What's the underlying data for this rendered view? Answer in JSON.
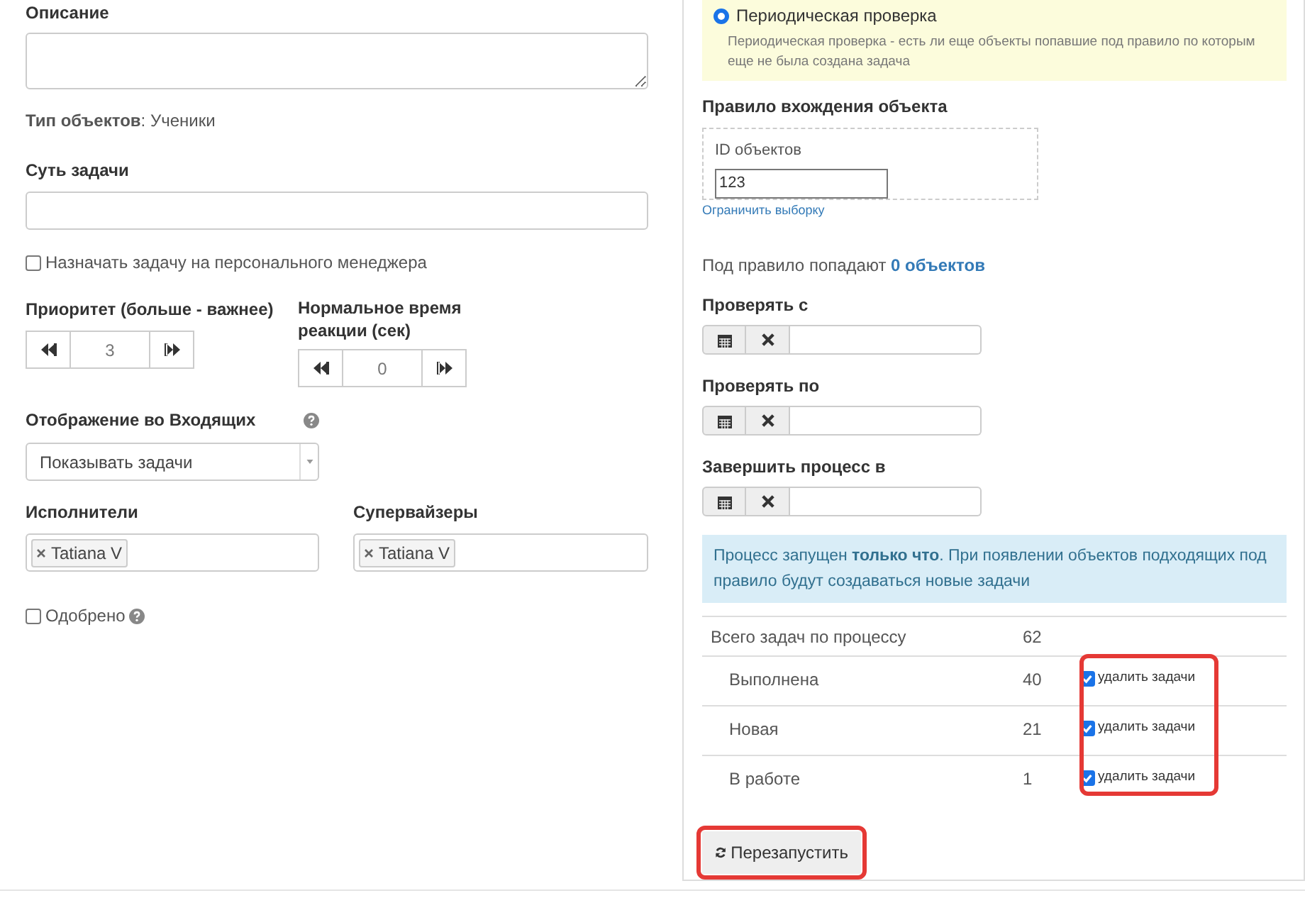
{
  "left": {
    "description": {
      "label": "Описание"
    },
    "object_type": "**Тип объектов**: Ученики",
    "task_essence": {
      "label": "Суть задачи"
    },
    "assign_manager": {
      "label": "Назначать задачу на персонального менеджера",
      "checked": false
    },
    "priority": {
      "label": "Приоритет (больше - важнее)",
      "value": "3"
    },
    "reaction_time": {
      "label": "Нормальное время реакции (сек)",
      "value": "0"
    },
    "inbox_display": {
      "label": "Отображение во Входящих",
      "value": "Показывать задачи"
    },
    "executors": {
      "label": "Исполнители",
      "tags": [
        "Tatiana V"
      ]
    },
    "supervisors": {
      "label": "Супервайзеры",
      "tags": [
        "Tatiana V"
      ]
    },
    "approved": {
      "label": "Одобрено",
      "checked": false
    }
  },
  "right": {
    "periodic": {
      "label": "Периодическая проверка",
      "selected": true,
      "hint": "Периодическая проверка - есть ли еще объекты попавшие под правило по которым еще не была создана задача"
    },
    "rule": {
      "title": "Правило вхождения объекта",
      "field_label": "ID объектов",
      "field_value": "123",
      "link": "Ограничить выборку"
    },
    "matches": {
      "text": "Под правило попадают",
      "count": "0 объектов"
    },
    "dates": [
      {
        "label": "Проверять с"
      },
      {
        "label": "Проверять по"
      },
      {
        "label": "Завершить процесс в"
      }
    ],
    "info": "Процесс запущен **только что**. При появлении объектов подходящих под правило будут создаваться новые задачи",
    "stats": {
      "total_label": "Всего задач по процессу",
      "total": "62",
      "highlighted": true,
      "rows": [
        {
          "label": "Выполнена",
          "count": "40",
          "option": "удалить задачи",
          "checked": true
        },
        {
          "label": "Новая",
          "count": "21",
          "option": "удалить задачи",
          "checked": true
        },
        {
          "label": "В работе",
          "count": "1",
          "option": "удалить задачи",
          "checked": true
        }
      ]
    },
    "restart_button": {
      "label": "Перезапустить",
      "highlighted": true
    }
  }
}
